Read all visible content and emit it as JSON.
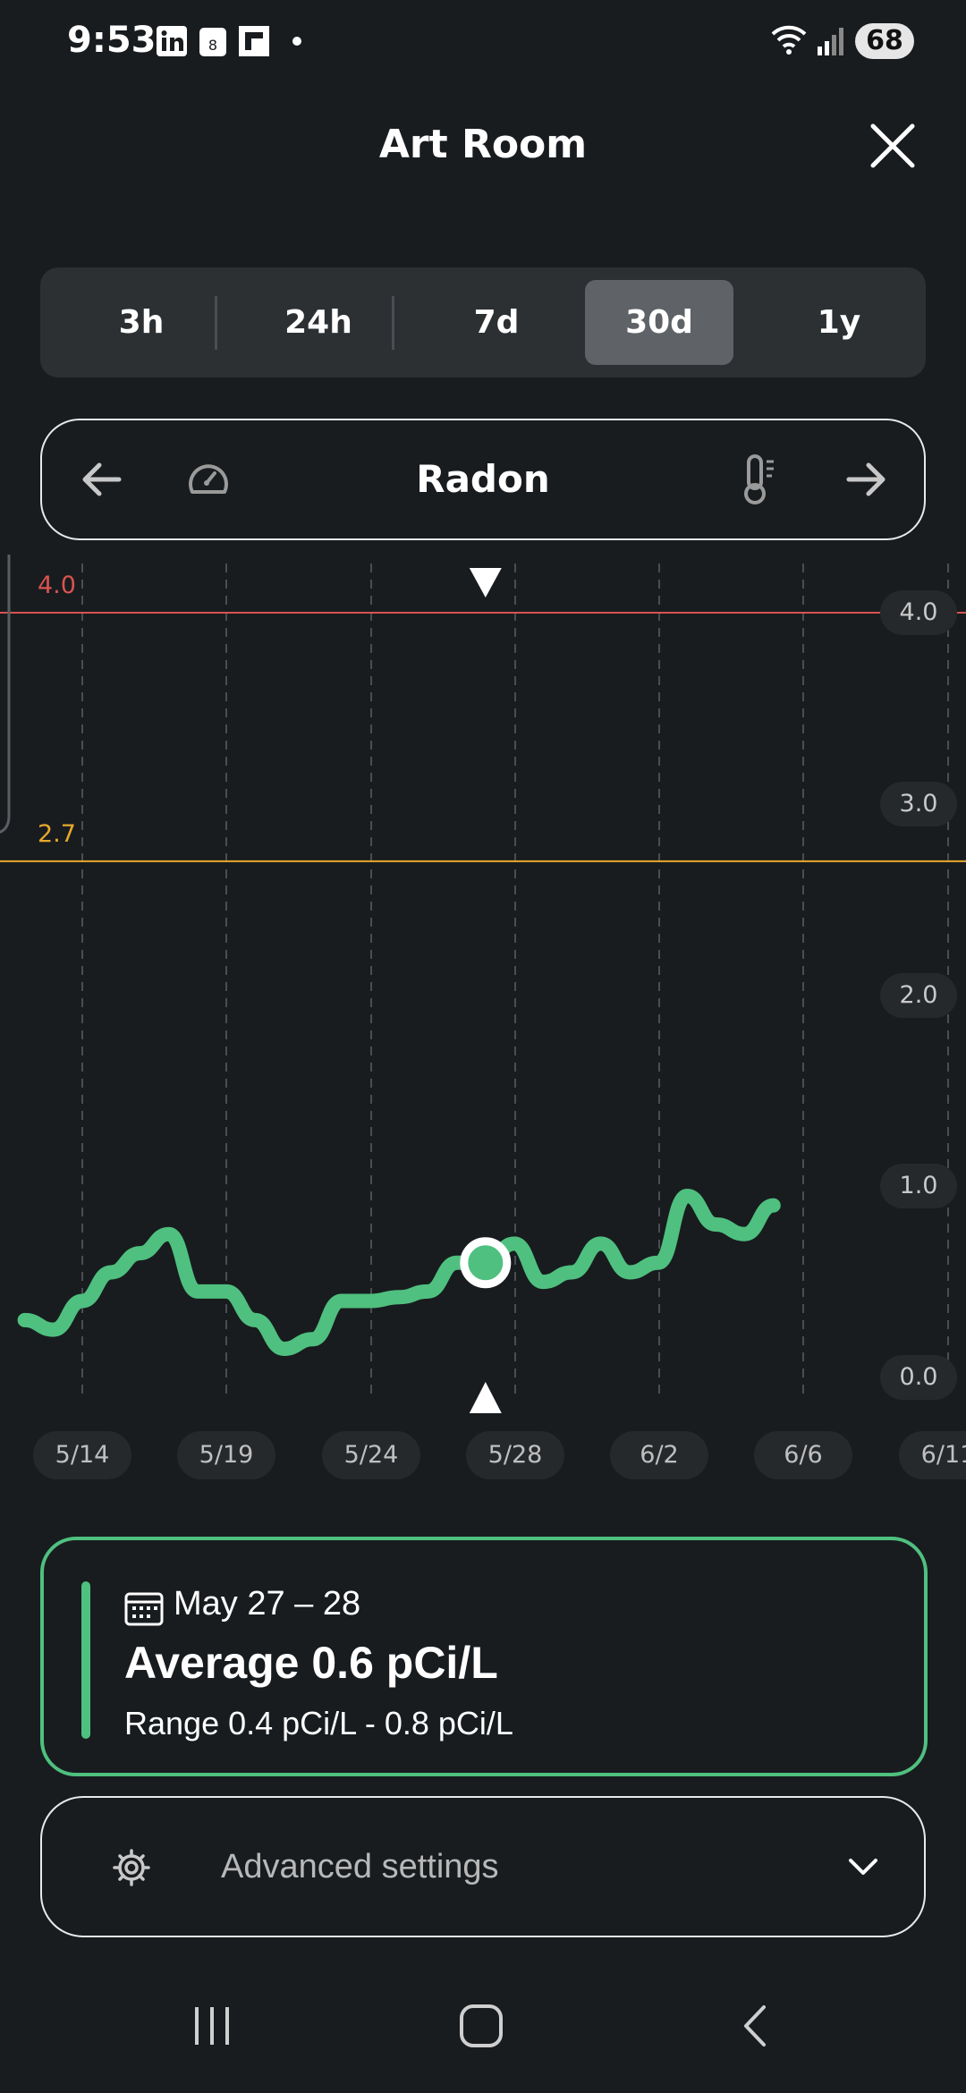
{
  "status_bar": {
    "time": "9:53",
    "battery": "68",
    "notification_icons": [
      "linkedin-icon",
      "calendar-icon",
      "flipboard-icon",
      "dot-icon"
    ]
  },
  "header": {
    "title": "Art Room"
  },
  "range_tabs": [
    {
      "label": "3h",
      "active": false
    },
    {
      "label": "24h",
      "active": false
    },
    {
      "label": "7d",
      "active": false
    },
    {
      "label": "30d",
      "active": true
    },
    {
      "label": "1y",
      "active": false
    }
  ],
  "sensor": {
    "name": "Radon"
  },
  "chart_data": {
    "type": "line",
    "x_labels": [
      "5/14",
      "5/19",
      "5/24",
      "5/28",
      "6/2",
      "6/6",
      "6/11"
    ],
    "y_ticks": [
      "4.0",
      "3.0",
      "2.0",
      "1.0",
      "0.0"
    ],
    "ylim": [
      0,
      4.0
    ],
    "thresholds": [
      {
        "value": 4.0,
        "label": "4.0",
        "color": "#d9534f"
      },
      {
        "value": 2.7,
        "label": "2.7",
        "color": "#e7a82b"
      }
    ],
    "series": [
      {
        "color": "#4fc07f",
        "x": [
          "5/12",
          "5/13",
          "5/14",
          "5/15",
          "5/16",
          "5/17",
          "5/18",
          "5/19",
          "5/20",
          "5/21",
          "5/22",
          "5/23",
          "5/24",
          "5/25",
          "5/26",
          "5/27",
          "5/28",
          "5/29",
          "5/30",
          "5/31",
          "6/1",
          "6/2",
          "6/3",
          "6/4",
          "6/5",
          "6/6",
          "6/7"
        ],
        "y": [
          0.3,
          0.25,
          0.4,
          0.55,
          0.65,
          0.75,
          0.45,
          0.45,
          0.3,
          0.15,
          0.2,
          0.4,
          0.4,
          0.42,
          0.45,
          0.6,
          0.6,
          0.7,
          0.5,
          0.55,
          0.7,
          0.55,
          0.6,
          0.95,
          0.8,
          0.75,
          0.9
        ]
      }
    ],
    "selected": {
      "x": "5/28",
      "y": 0.6
    }
  },
  "summary": {
    "date": "May 27 – 28",
    "average": "Average 0.6 pCi/L",
    "range": "Range 0.4 pCi/L - 0.8 pCi/L",
    "accent": "#4fc07f"
  },
  "advanced": {
    "label": "Advanced settings"
  }
}
